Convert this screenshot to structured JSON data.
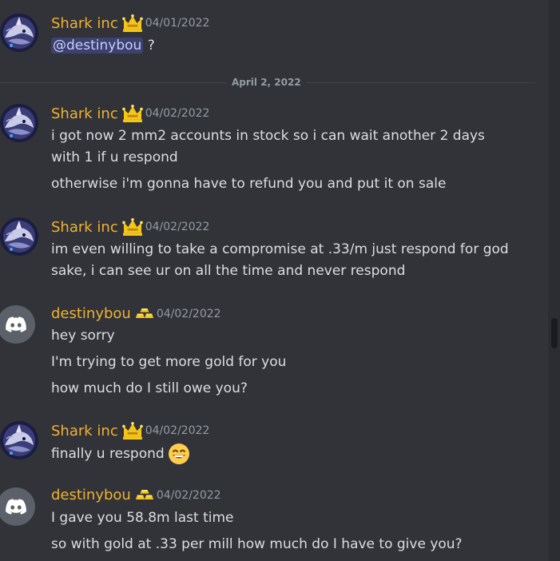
{
  "messages": [
    {
      "username": "Shark inc",
      "timestamp": "04/01/2022",
      "mention": "@destinybou",
      "text": "?"
    },
    {
      "divider": "April 2, 2022"
    },
    {
      "username": "Shark inc",
      "timestamp": "04/02/2022",
      "lines": [
        "i got now 2 mm2 accounts in stock so i can wait another 2 days",
        "with 1 if u respond",
        "otherwise i'm gonna have to refund you and put it on sale"
      ]
    },
    {
      "username": "Shark inc",
      "timestamp": "04/02/2022",
      "lines": [
        "im even willing to take a compromise at .33/m just respond for god",
        "sake, i can see ur on all the time and never respond"
      ]
    },
    {
      "username": "destinybou",
      "timestamp": "04/02/2022",
      "lines": [
        "hey sorry",
        "I'm trying to get more gold for you",
        "how much do I still owe you?"
      ]
    },
    {
      "username": "Shark inc",
      "timestamp": "04/02/2022",
      "lines": [
        "finally u respond"
      ],
      "emoji": "grinning-face-emoji"
    },
    {
      "username": "destinybou",
      "timestamp": "04/02/2022",
      "lines": [
        "I gave you 58.8m last time",
        "so with gold at .33 per mill how much do I have to give you?"
      ]
    }
  ],
  "colors": {
    "background": "#313338",
    "username": "#f0b232",
    "text": "#dbdee1",
    "timestamp": "#949ba4",
    "mention_bg": "#3c4270",
    "mention_text": "#c9cdfb"
  },
  "icons": {
    "shark_badge": "crown-icon",
    "destiny_badge": "gold-bars-icon",
    "discord_avatar": "discord-logo-icon",
    "shark_avatar": "shark-avatar-image"
  }
}
